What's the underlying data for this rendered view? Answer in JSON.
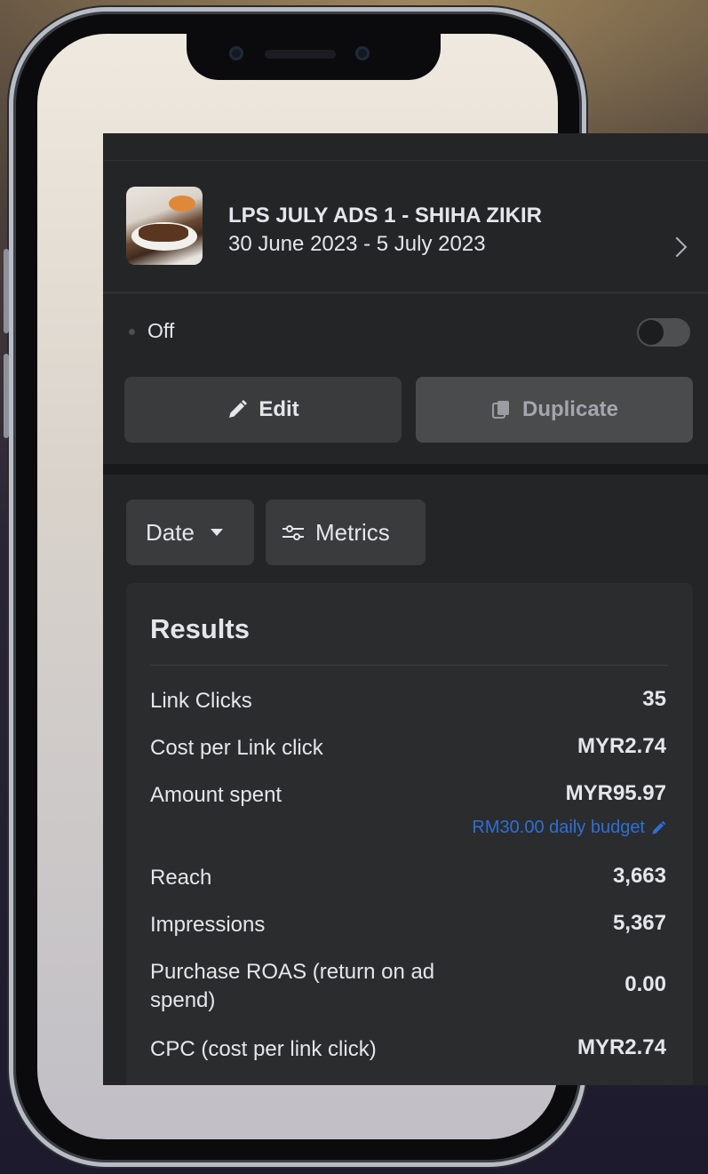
{
  "ad": {
    "name": "LPS JULY ADS 1 - SHIHA ZIKIR",
    "date_range": "30 June 2023 - 5 July 2023"
  },
  "status": {
    "label": "Off",
    "enabled": false
  },
  "actions": {
    "edit_label": "Edit",
    "duplicate_label": "Duplicate"
  },
  "filters": {
    "date_label": "Date",
    "metrics_label": "Metrics"
  },
  "results": {
    "title": "Results",
    "rows": [
      {
        "label": "Link Clicks",
        "value": "35"
      },
      {
        "label": "Cost per Link click",
        "value": "MYR2.74"
      },
      {
        "label": "Amount spent",
        "value": "MYR95.97"
      },
      {
        "label": "Reach",
        "value": "3,663"
      },
      {
        "label": "Impressions",
        "value": "5,367"
      },
      {
        "label": "Purchase ROAS (return on ad spend)",
        "value": "0.00"
      },
      {
        "label": "CPC (cost per link click)",
        "value": "MYR2.74"
      }
    ],
    "budget_link": "RM30.00 daily budget"
  },
  "colors": {
    "panel_bg": "#242526",
    "button_bg": "#3a3b3c",
    "text": "#e4e6eb",
    "link": "#2d6fd8"
  },
  "icons": [
    "chevron-right-icon",
    "pencil-icon",
    "duplicate-icon",
    "caret-down-icon",
    "sliders-icon",
    "pencil-small-icon"
  ]
}
